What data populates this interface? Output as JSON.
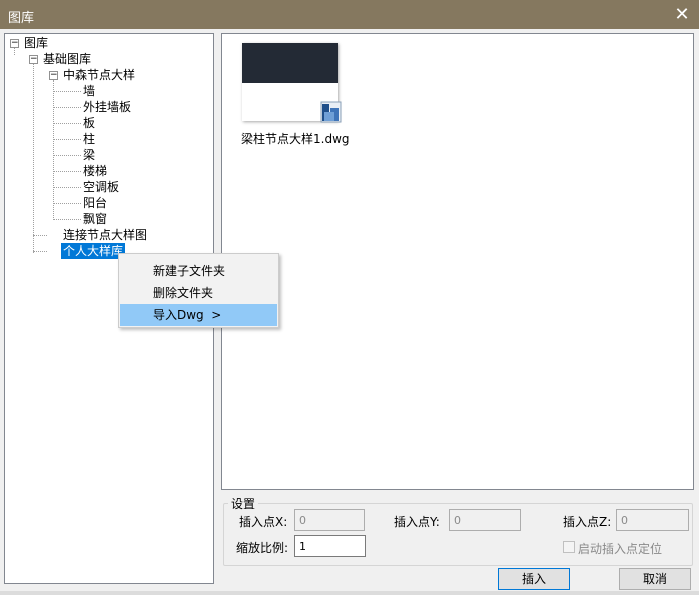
{
  "window": {
    "title": "图库",
    "close_glyph": "✕"
  },
  "tree": {
    "root": "图库",
    "basic": "基础图库",
    "zhongsen": "中森节点大样",
    "items": [
      "墙",
      "外挂墙板",
      "板",
      "柱",
      "梁",
      "楼梯",
      "空调板",
      "阳台",
      "飘窗"
    ],
    "connection": "连接节点大样图",
    "personal": "个人大样库",
    "expand_glyph": "−"
  },
  "preview": {
    "file_name": "梁柱节点大样1.dwg"
  },
  "context_menu": {
    "items": [
      "新建子文件夹",
      "删除文件夹",
      "导入Dwg  >"
    ],
    "highlight_index": 2
  },
  "settings": {
    "group_title": "设置",
    "insert_x_label": "插入点X:",
    "insert_x_value": "0",
    "insert_y_label": "插入点Y:",
    "insert_y_value": "0",
    "insert_z_label": "插入点Z:",
    "insert_z_value": "0",
    "scale_label": "缩放比例:",
    "scale_value": "1",
    "auto_locate_label": "启动插入点定位"
  },
  "buttons": {
    "insert": "插入",
    "cancel": "取消"
  },
  "colors": {
    "titlebar": "#85785f",
    "selection": "#0078d7",
    "menu_highlight": "#91c9f7"
  },
  "icons": {
    "close": "close-icon",
    "expand": "minus-box-icon",
    "dwg": "dwg-file-icon"
  }
}
